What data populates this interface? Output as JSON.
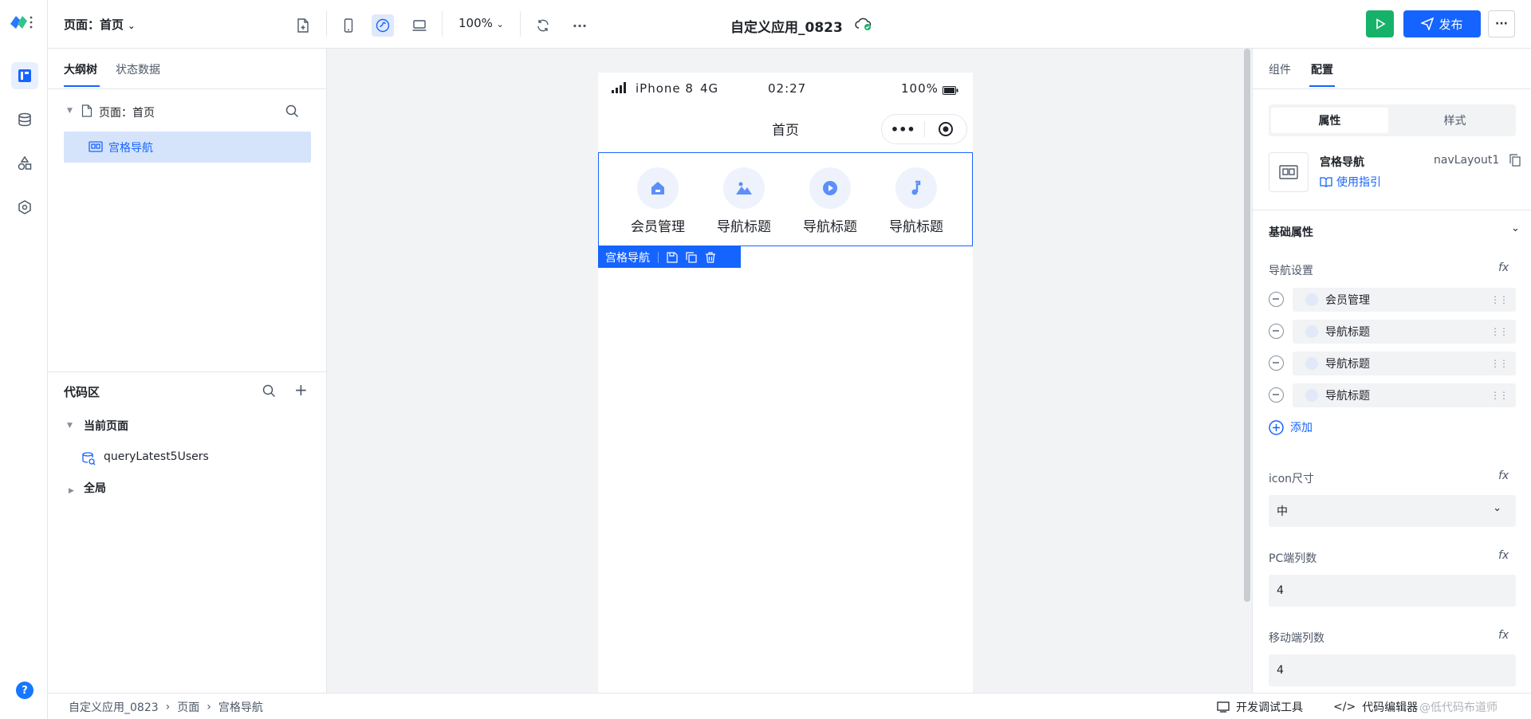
{
  "topbar": {
    "page_selector": "页面：首页",
    "zoom": "100%",
    "app_title": "自定义应用_0823",
    "publish_label": "发布"
  },
  "left_panel": {
    "tabs": [
      "大纲树",
      "状态数据"
    ],
    "tree": {
      "page_node": "页面：首页",
      "selected_node": "宫格导航"
    },
    "code_area": {
      "title": "代码区",
      "current_page_group": "当前页面",
      "current_page_item": "queryLatest5Users",
      "global_group": "全局"
    }
  },
  "phone": {
    "device": "iPhone 8",
    "network": "4G",
    "time": "02:27",
    "battery": "100%",
    "nav_title": "首页",
    "grid_items": [
      {
        "label": "会员管理",
        "icon": "home-icon"
      },
      {
        "label": "导航标题",
        "icon": "mountain-icon"
      },
      {
        "label": "导航标题",
        "icon": "play-icon"
      },
      {
        "label": "导航标题",
        "icon": "music-icon"
      }
    ],
    "selection_tag": "宫格导航"
  },
  "right_panel": {
    "tabs": [
      "组件",
      "配置"
    ],
    "segment": [
      "属性",
      "样式"
    ],
    "component_name": "宫格导航",
    "component_id": "navLayout1",
    "guide_link": "使用指引",
    "section_title": "基础属性",
    "nav_settings_label": "导航设置",
    "nav_items": [
      "会员管理",
      "导航标题",
      "导航标题",
      "导航标题"
    ],
    "add_label": "添加",
    "icon_size_label": "icon尺寸",
    "icon_size_value": "中",
    "pc_cols_label": "PC端列数",
    "pc_cols_value": "4",
    "mobile_cols_label": "移动端列数",
    "mobile_cols_value": "4",
    "fx": "fx"
  },
  "bottombar": {
    "breadcrumb": [
      "自定义应用_0823",
      "页面",
      "宫格导航"
    ],
    "dev_tools": "开发调试工具",
    "code_editor": "代码编辑器",
    "watermark": "@低代码布道师"
  },
  "colors": {
    "accent": "#1664ff",
    "run": "#17b26a",
    "selection_bg": "#d6e4fb"
  }
}
